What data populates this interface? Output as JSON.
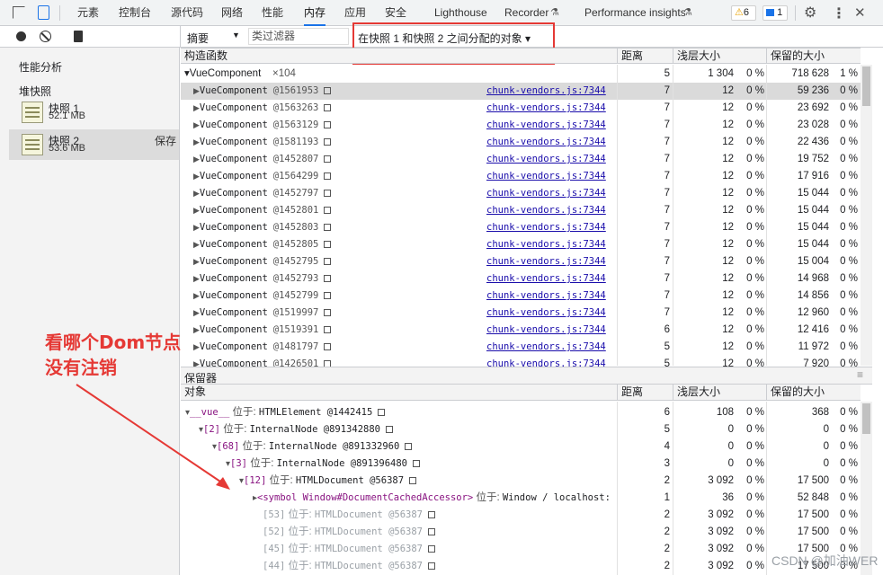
{
  "tabs": [
    "元素",
    "控制台",
    "源代码",
    "网络",
    "性能",
    "内存",
    "应用",
    "安全",
    "Lighthouse",
    "Recorder",
    "Performance insights"
  ],
  "badges": {
    "warnings": "6",
    "messages": "1"
  },
  "toolbar": {
    "view": "摘要",
    "class_filter": "类过滤器",
    "comparison": "在快照 1 和快照 2 之间分配的对象 ▾"
  },
  "sidebar": {
    "profiles_title": "性能分析",
    "heap_title": "堆快照",
    "snapshots": [
      {
        "name": "快照 1",
        "size": "52.1 MB"
      },
      {
        "name": "快照 2",
        "size": "53.6 MB",
        "save": "保存"
      }
    ]
  },
  "grid": {
    "headers": [
      "构造函数",
      "距离",
      "浅层大小",
      "保留的大小"
    ],
    "group": {
      "name": "▾VueComponent",
      "count": "×104",
      "distance": "5",
      "shallow": "1 304",
      "shallow_pct": "0 %",
      "retained": "718 628",
      "retained_pct": "1 %"
    },
    "rows": [
      {
        "id": "@1561953",
        "dist": "7",
        "ret": "59 236"
      },
      {
        "id": "@1563263",
        "dist": "7",
        "ret": "23 692"
      },
      {
        "id": "@1563129",
        "dist": "7",
        "ret": "23 028"
      },
      {
        "id": "@1581193",
        "dist": "7",
        "ret": "22 436"
      },
      {
        "id": "@1452807",
        "dist": "7",
        "ret": "19 752"
      },
      {
        "id": "@1564299",
        "dist": "7",
        "ret": "17 916"
      },
      {
        "id": "@1452797",
        "dist": "7",
        "ret": "15 044"
      },
      {
        "id": "@1452801",
        "dist": "7",
        "ret": "15 044"
      },
      {
        "id": "@1452803",
        "dist": "7",
        "ret": "15 044"
      },
      {
        "id": "@1452805",
        "dist": "7",
        "ret": "15 044"
      },
      {
        "id": "@1452795",
        "dist": "7",
        "ret": "15 004"
      },
      {
        "id": "@1452793",
        "dist": "7",
        "ret": "14 968"
      },
      {
        "id": "@1452799",
        "dist": "7",
        "ret": "14 856"
      },
      {
        "id": "@1519997",
        "dist": "7",
        "ret": "12 960"
      },
      {
        "id": "@1519391",
        "dist": "6",
        "ret": "12 416"
      },
      {
        "id": "@1481797",
        "dist": "5",
        "ret": "11 972"
      },
      {
        "id": "@1426501",
        "dist": "5",
        "ret": "7 920"
      }
    ],
    "row_name": "VueComponent",
    "source": "chunk-vendors.js:7344",
    "shallow": "12",
    "pct": "0 %"
  },
  "retainers": {
    "title": "保留器",
    "headers": [
      "对象",
      "距离",
      "浅层大小",
      "保留的大小"
    ],
    "rows": [
      {
        "indent": 0,
        "arrow": "▾",
        "key": "__vue__",
        "sep": " 位于: ",
        "obj": "HTMLElement @1442415",
        "dist": "6",
        "shallow": "108",
        "ret": "368",
        "style": "purple"
      },
      {
        "indent": 1,
        "arrow": "▾",
        "key": "[2]",
        "sep": " 位于: ",
        "obj": "InternalNode @891342880",
        "dist": "5",
        "shallow": "0",
        "ret": "0",
        "style": "purple"
      },
      {
        "indent": 2,
        "arrow": "▾",
        "key": "[68]",
        "sep": " 位于: ",
        "obj": "InternalNode @891332960",
        "dist": "4",
        "shallow": "0",
        "ret": "0",
        "style": "purple"
      },
      {
        "indent": 3,
        "arrow": "▾",
        "key": "[3]",
        "sep": " 位于: ",
        "obj": "InternalNode @891396480",
        "dist": "3",
        "shallow": "0",
        "ret": "0",
        "style": "purple"
      },
      {
        "indent": 4,
        "arrow": "▾",
        "key": "[12]",
        "sep": " 位于: ",
        "obj": "HTMLDocument @56387",
        "dist": "2",
        "shallow": "3 092",
        "ret": "17 500",
        "style": "purple"
      },
      {
        "indent": 5,
        "arrow": "▸",
        "key": "<symbol Window#DocumentCachedAccessor>",
        "sep": " 位于: ",
        "obj": "Window / localhost:",
        "dist": "1",
        "shallow": "36",
        "ret": "52 848",
        "style": "purple"
      },
      {
        "indent": 5,
        "arrow": "",
        "key": "[53]",
        "sep": " 位于: ",
        "obj": "HTMLDocument @56387",
        "dist": "2",
        "shallow": "3 092",
        "ret": "17 500",
        "style": "gray"
      },
      {
        "indent": 5,
        "arrow": "",
        "key": "[52]",
        "sep": " 位于: ",
        "obj": "HTMLDocument @56387",
        "dist": "2",
        "shallow": "3 092",
        "ret": "17 500",
        "style": "gray"
      },
      {
        "indent": 5,
        "arrow": "",
        "key": "[45]",
        "sep": " 位于: ",
        "obj": "HTMLDocument @56387",
        "dist": "2",
        "shallow": "3 092",
        "ret": "17 500",
        "style": "gray"
      },
      {
        "indent": 5,
        "arrow": "",
        "key": "[44]",
        "sep": " 位于: ",
        "obj": "HTMLDocument @56387",
        "dist": "2",
        "shallow": "3 092",
        "ret": "17 500",
        "style": "gray"
      }
    ],
    "pct": "0 %"
  },
  "annotation": {
    "line1": "看哪个Dom节点",
    "line2": "没有注销",
    "color": "#e53935"
  },
  "watermark": "CSDN @加油WER"
}
